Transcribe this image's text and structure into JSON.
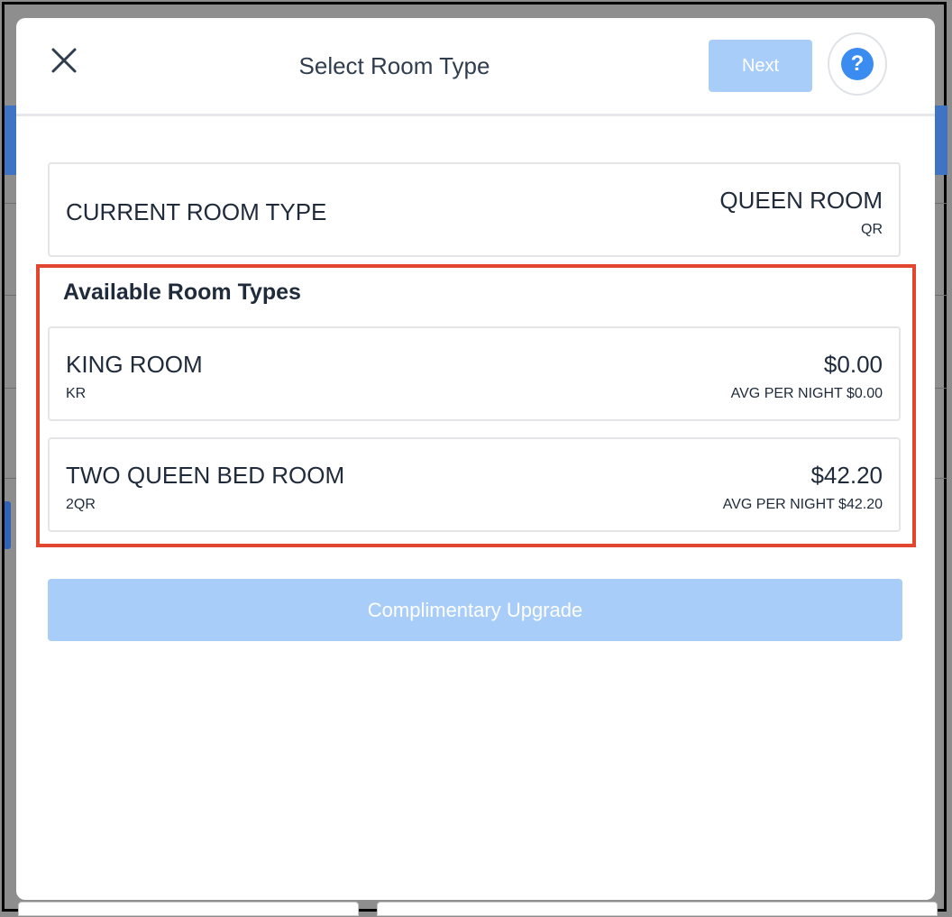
{
  "modal": {
    "title": "Select Room Type",
    "next_label": "Next",
    "help_glyph": "?"
  },
  "current_room": {
    "label": "CURRENT ROOM TYPE",
    "name": "QUEEN ROOM",
    "code": "QR"
  },
  "available": {
    "title": "Available Room Types",
    "rooms": [
      {
        "name": "KING ROOM",
        "code": "KR",
        "price": "$0.00",
        "avg": "AVG PER NIGHT $0.00"
      },
      {
        "name": "TWO QUEEN BED ROOM",
        "code": "2QR",
        "price": "$42.20",
        "avg": "AVG PER NIGHT $42.20"
      }
    ]
  },
  "upgrade_label": "Complimentary Upgrade",
  "colors": {
    "accent_light": "#a9cdf9",
    "help_blue": "#3b8cf0",
    "highlight_red": "#e3462f"
  },
  "icons": {
    "close": "close-icon",
    "help": "help-icon"
  }
}
